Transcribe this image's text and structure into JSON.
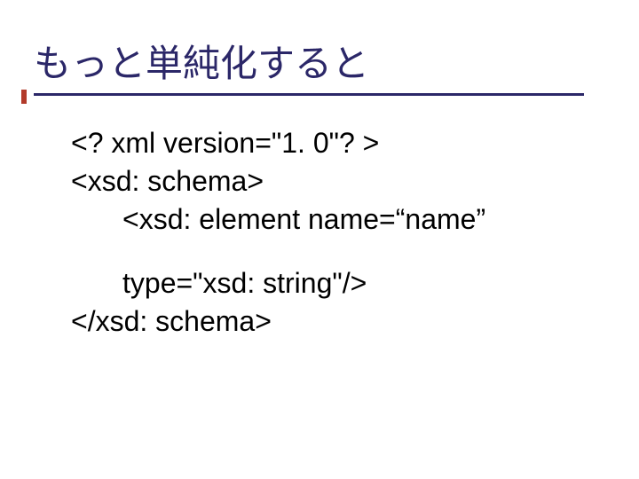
{
  "title": "もっと単純化すると",
  "code": {
    "l1": "<? xml version=\"1. 0\"? >",
    "l2": "<xsd: schema>",
    "l3": "<xsd: element name=“name”",
    "l4": "type=\"xsd: string\"/>",
    "l5": "</xsd: schema>"
  }
}
